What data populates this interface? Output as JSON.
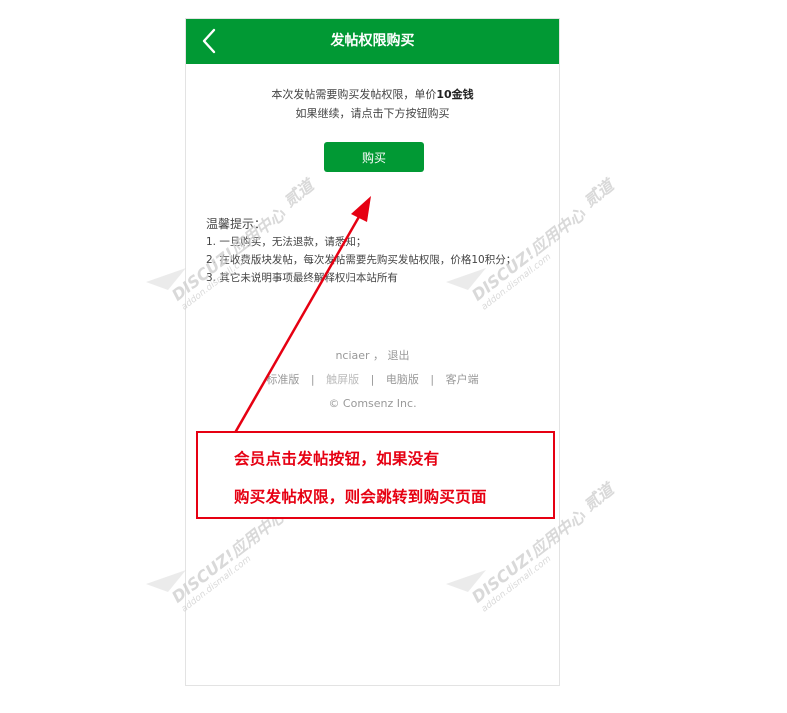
{
  "header": {
    "title": "发帖权限购买",
    "back_icon": "chevron-left-icon",
    "background_color": "#019934"
  },
  "notice": {
    "line1_prefix": "本次发帖需要购买发帖权限，单价",
    "line1_price": "10金钱",
    "line2": "如果继续，请点击下方按钮购买"
  },
  "buy_button": {
    "label": "购买"
  },
  "tips": {
    "title": "温馨提示：",
    "items": [
      "1. 一旦购买，无法退款，请悉知；",
      "2. 在收费版块发帖，每次发帖需要先购买发帖权限，价格10积分；",
      "3. 其它未说明事项最终解释权归本站所有"
    ]
  },
  "footer": {
    "username": "nciaer",
    "comma": "，",
    "logout": "退出",
    "links": [
      "标准版",
      "触屏版",
      "电脑版",
      "客户端"
    ],
    "separator": "|",
    "copyright": "© Comsenz Inc."
  },
  "annotation": {
    "line1": "会员点击发帖按钮，如果没有",
    "line2": "购买发帖权限，则会跳转到购买页面",
    "color": "#e60012"
  },
  "watermark": {
    "brand": "DISCUZ!应用中心",
    "domain": "addon.dismall.com",
    "extra": "贰道"
  }
}
